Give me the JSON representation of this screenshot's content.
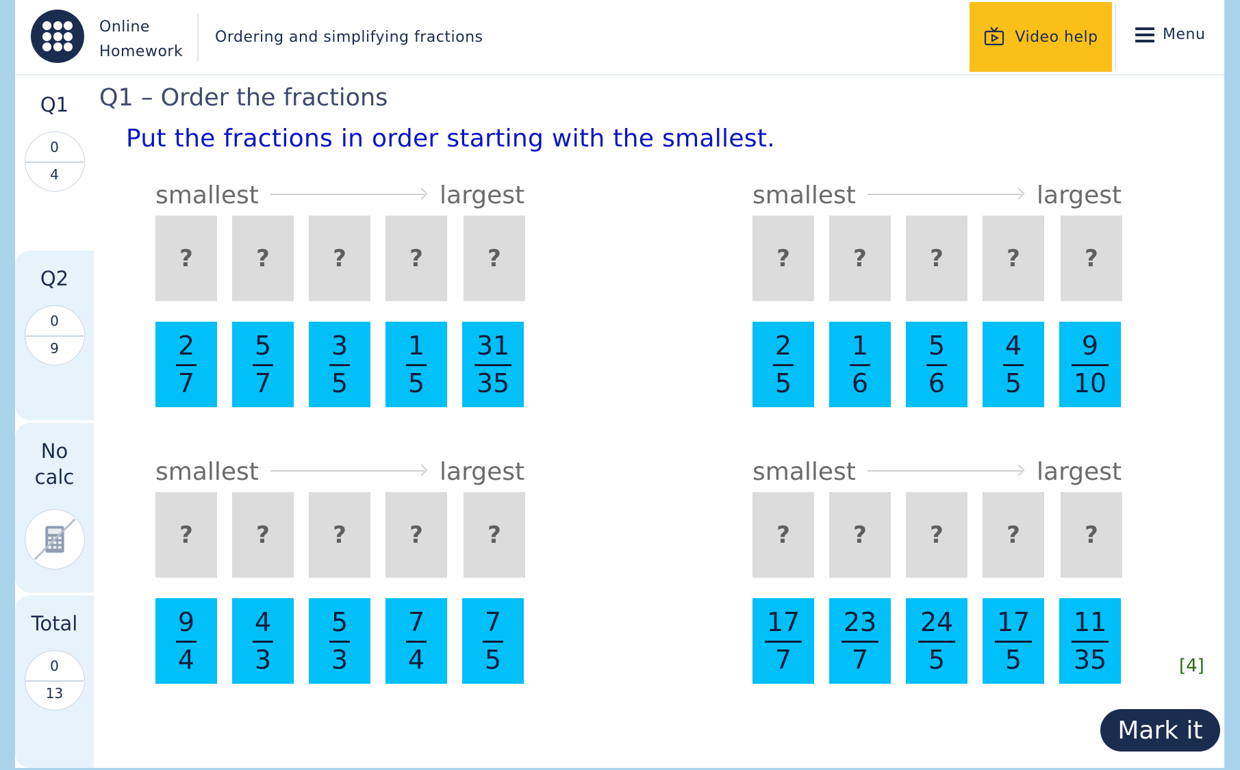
{
  "header": {
    "brand_line1": "Online",
    "brand_line2": "Homework",
    "title": "Ordering and simplifying fractions",
    "video_help": "Video help",
    "menu": "Menu"
  },
  "sidebar": {
    "q1": {
      "label": "Q1",
      "score": "0",
      "max": "4"
    },
    "q2": {
      "label": "Q2",
      "score": "0",
      "max": "9"
    },
    "calc": {
      "line1": "No",
      "line2": "calc",
      "icon": "no-calculator-icon"
    },
    "total": {
      "label": "Total",
      "score": "0",
      "max": "13"
    }
  },
  "question": {
    "heading": "Q1 – Order the fractions",
    "instruction": "Put the fractions in order starting with the smallest.",
    "smallest_label": "smallest",
    "largest_label": "largest",
    "slot_placeholder": "?",
    "groups": [
      {
        "cards": [
          {
            "n": "2",
            "d": "7"
          },
          {
            "n": "5",
            "d": "7"
          },
          {
            "n": "3",
            "d": "5"
          },
          {
            "n": "1",
            "d": "5"
          },
          {
            "n": "31",
            "d": "35"
          }
        ]
      },
      {
        "cards": [
          {
            "n": "2",
            "d": "5"
          },
          {
            "n": "1",
            "d": "6"
          },
          {
            "n": "5",
            "d": "6"
          },
          {
            "n": "4",
            "d": "5"
          },
          {
            "n": "9",
            "d": "10"
          }
        ]
      },
      {
        "cards": [
          {
            "n": "9",
            "d": "4"
          },
          {
            "n": "4",
            "d": "3"
          },
          {
            "n": "5",
            "d": "3"
          },
          {
            "n": "7",
            "d": "4"
          },
          {
            "n": "7",
            "d": "5"
          }
        ]
      },
      {
        "cards": [
          {
            "n": "17",
            "d": "7"
          },
          {
            "n": "23",
            "d": "7"
          },
          {
            "n": "24",
            "d": "5"
          },
          {
            "n": "17",
            "d": "5"
          },
          {
            "n": "11",
            "d": "35"
          }
        ]
      }
    ],
    "marks": "[4]",
    "mark_button": "Mark it"
  },
  "colors": {
    "navy": "#1b2d4f",
    "accent_yellow": "#fbbf19",
    "card_blue": "#00bff9",
    "slot_grey": "#dcdcdc",
    "instruction_blue": "#0a14c8",
    "marks_green": "#2b6e12"
  }
}
